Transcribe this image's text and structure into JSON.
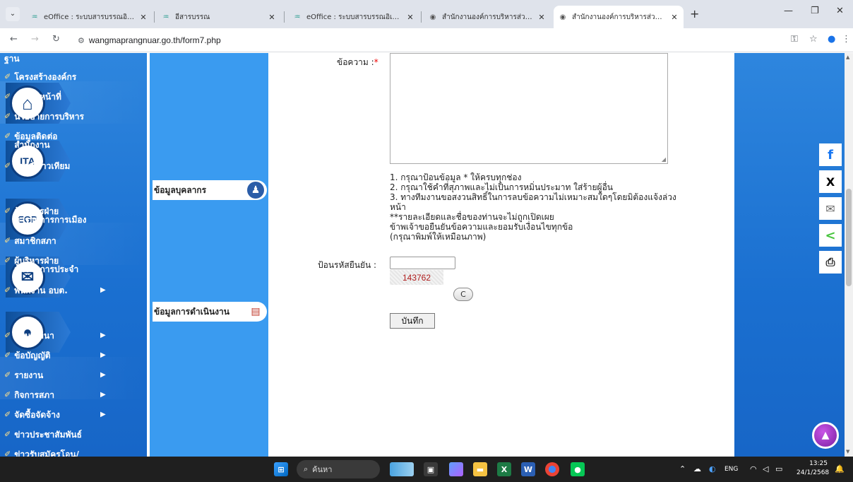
{
  "browser": {
    "tabs": [
      {
        "title": "eOffice : ระบบสารบรรณอิเล็กทรอนิ...",
        "favicon": "eoffice-icon",
        "active": false
      },
      {
        "title": "อีสารบรรณ",
        "favicon": "eoffice-icon",
        "active": false
      },
      {
        "title": "eOffice : ระบบสารบรรณอิเล็กทรอนิ...",
        "favicon": "eoffice-icon",
        "active": false
      },
      {
        "title": "สำนักงานองค์การบริหารส่วนตำบลวัง...",
        "favicon": "globe-icon",
        "active": false
      },
      {
        "title": "สำนักงานองค์การบริหารส่วนตำบลวัง...",
        "favicon": "globe-icon",
        "active": true
      }
    ],
    "url": "wangmaprangnuar.go.th/form7.php"
  },
  "sidebar": {
    "icons": [
      {
        "name": "home-icon",
        "glyph": "⌂"
      },
      {
        "name": "ita-icon",
        "glyph": "ITA"
      },
      {
        "name": "egp-icon",
        "glyph": "EGP"
      },
      {
        "name": "mail-icon",
        "glyph": "✉"
      },
      {
        "name": "user-icon",
        "glyph": "●"
      }
    ]
  },
  "menu": {
    "top_fragment": "ฐาน",
    "items_group1": [
      "โครงสร้างองค์กร",
      "อำนาจหน้าที่",
      "นโยบายการบริหาร",
      "ข้อมูลติดต่อสำนักงาน",
      "แผนที่ดาวเทียม"
    ],
    "head_personnel": "ข้อมูลบุคลากร",
    "items_group2": [
      "ผู้บริหารฝ่ายข้าราชการการเมือง",
      "สมาชิกสภา",
      "ผู้บริหารฝ่ายข้าราชการประจำ",
      "พนักงาน อบต."
    ],
    "head_operations": "ข้อมูลการดำเนินงาน",
    "items_group3": [
      "แผนพัฒนา",
      "ข้อบัญญัติ",
      "รายงาน",
      "กิจการสภา",
      "จัดซื้อจัดจ้าง",
      "ข่าวประชาสัมพันธ์",
      "ข่าวรับสมัครโอน/"
    ]
  },
  "form": {
    "message_label": "ข้อความ :",
    "required_mark": "*",
    "notes": [
      "1. กรุณาป้อนข้อมูล * ให้ครบทุกช่อง",
      "2. กรุณาใช้คำที่สุภาพและไม่เป็นการหมิ่นประมาท ใส่ร้ายผู้อื่น",
      "3. ทางทีมงานขอสงวนสิทธิ์ในการลบข้อความไม่เหมาะสมใดๆโดยมิต้องแจ้งล่วงหน้า",
      "**รายละเอียดและชื่อของท่านจะไม่ถูกเปิดเผย",
      "ข้าพเจ้าขอยืนยันข้อความและยอมรับเงื่อนไขทุกข้อ",
      "(กรุณาพิมพ์ให้เหมือนภาพ)"
    ],
    "captcha_label": "ป้อนรหัสยืนยัน :",
    "captcha_code": "143762",
    "refresh_glyph": "C",
    "save_label": "บันทึก"
  },
  "share_buttons": [
    {
      "name": "facebook-icon",
      "glyph": "f",
      "color": "#1877f2"
    },
    {
      "name": "x-icon",
      "glyph": "X",
      "color": "#000000"
    },
    {
      "name": "email-icon",
      "glyph": "✉",
      "color": "#666666"
    },
    {
      "name": "share-icon",
      "glyph": "<",
      "color": "#46c43c"
    },
    {
      "name": "print-icon",
      "glyph": "⎙",
      "color": "#222222"
    }
  ],
  "taskbar": {
    "search_placeholder": "ค้นหา",
    "lang": "ENG",
    "time": "13:25",
    "date": "24/1/2568"
  }
}
